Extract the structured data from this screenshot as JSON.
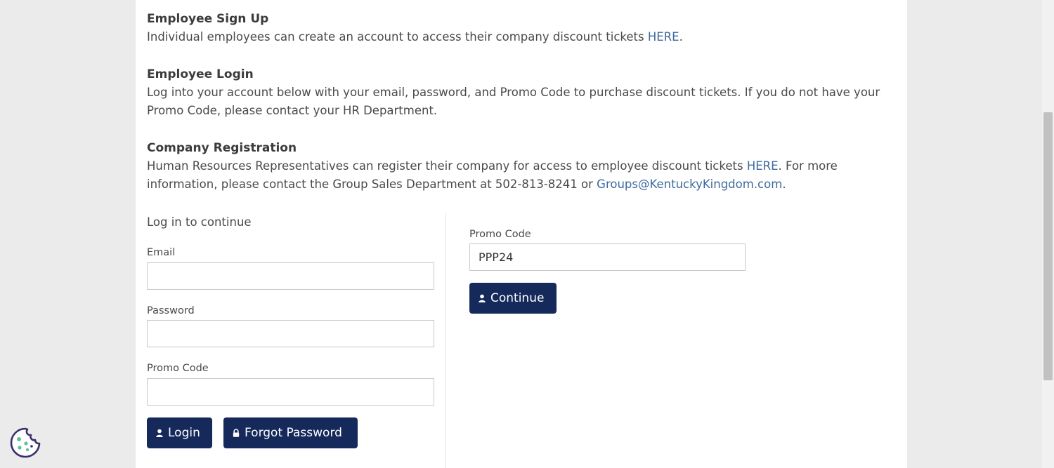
{
  "signup": {
    "title": "Employee Sign Up",
    "text": "Individual employees can create an account to access their company discount tickets ",
    "link": "HERE",
    "suffix": "."
  },
  "login_info": {
    "title": "Employee Login",
    "text": "Log into your account below with your email, password, and Promo Code to purchase discount tickets. If you do not have your Promo Code, please contact your HR Department."
  },
  "company": {
    "title": "Company Registration",
    "text_before": "Human Resources Representatives can register their company for access to employee discount tickets ",
    "link_here": "HERE",
    "text_middle": ". For more information, please contact the Group Sales Department at 502-813-8241 or ",
    "email_link": "Groups@KentuckyKingdom.com",
    "suffix": "."
  },
  "login_form": {
    "heading": "Log in to continue",
    "email_label": "Email",
    "email_value": "",
    "password_label": "Password",
    "password_value": "",
    "promo_label": "Promo Code",
    "promo_value": "",
    "login_button": "Login",
    "forgot_button": "Forgot Password"
  },
  "promo_form": {
    "promo_label": "Promo Code",
    "promo_value": "PPP24",
    "continue_button": "Continue"
  },
  "colors": {
    "button_bg": "#15295b",
    "link": "#3d6a9e"
  },
  "icons": [
    "user-icon",
    "lock-icon",
    "cookie-icon"
  ]
}
